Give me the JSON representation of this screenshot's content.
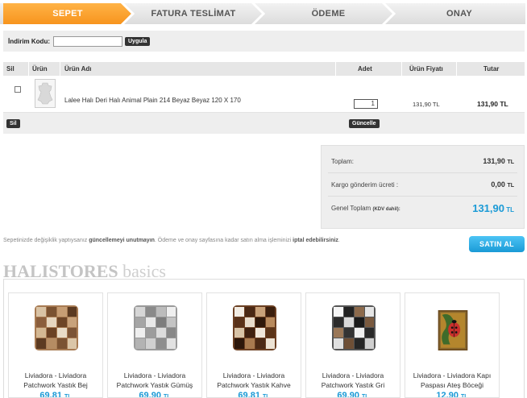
{
  "steps": [
    "SEPET",
    "FATURA TESLİMAT",
    "ÖDEME",
    "ONAY"
  ],
  "promo": {
    "label": "İndirim Kodu:",
    "value": "",
    "placeholder": "",
    "button": "Uygula"
  },
  "cart": {
    "headers": [
      "Sil",
      "Ürün",
      "Ürün Adı",
      "Adet",
      "Ürün Fiyatı",
      "Tutar"
    ],
    "item": {
      "name": "Lalee Halı Deri Halı Animal Plain 214 Beyaz Beyaz 120 X 170",
      "qty": "1",
      "price": "131,90 TL",
      "total": "131,90 TL"
    },
    "delete_btn": "Sil",
    "update_btn": "Güncelle"
  },
  "totals": {
    "subtotal_label": "Toplam:",
    "subtotal": "131,90",
    "shipping_label": "Kargo gönderim ücreti :",
    "shipping": "0,00",
    "grand_label": "Genel Toplam",
    "vat_note": "(KDV dahil):",
    "grand": "131,90",
    "currency": "TL"
  },
  "note": {
    "part1": "Sepetinizde değişiklik yaptıysanız ",
    "bold1": "güncellemeyi unutmayın",
    "part2": ". Ödeme ve onay sayfasına kadar satın alma işleminizi ",
    "bold2": "iptal edebilirsiniz",
    "part3": "."
  },
  "buy_button": "SATIN AL",
  "brand": {
    "bold": "HALISTORES",
    "rest": " basics"
  },
  "products": [
    {
      "name": "Liviadora - Liviadora Patchwork Yastık Bej",
      "price": "69,81",
      "currency": "TL"
    },
    {
      "name": "Liviadora - Liviadora Patchwork Yastık Gümüş",
      "price": "69,90",
      "currency": "TL"
    },
    {
      "name": "Liviadora - Liviadora Patchwork Yastık Kahve",
      "price": "69,81",
      "currency": "TL"
    },
    {
      "name": "Liviadora - Liviadora Patchwork Yastık Gri",
      "price": "69,90",
      "currency": "TL"
    },
    {
      "name": "Liviadora - Liviadora Kapı Paspası Ateş Böceği",
      "price": "12,90",
      "currency": "TL"
    }
  ],
  "colors": {
    "accent_orange": "#f7941d",
    "accent_blue": "#1a9ad6"
  }
}
